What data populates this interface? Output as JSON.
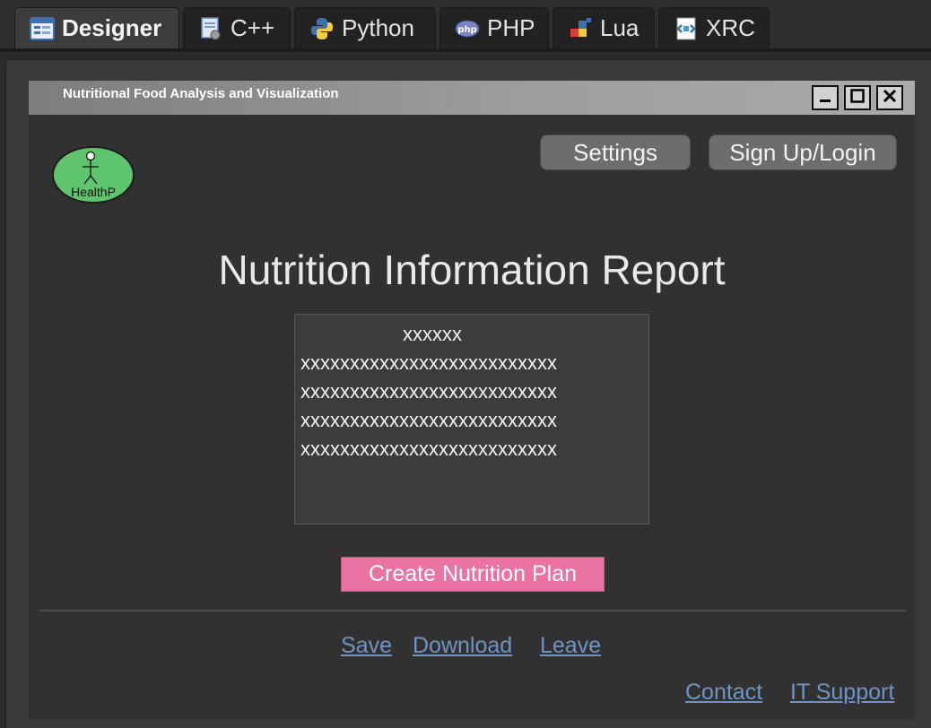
{
  "tabs": [
    {
      "label": "Designer",
      "icon": "designer-form-icon"
    },
    {
      "label": "C++",
      "icon": "cpp-file-icon"
    },
    {
      "label": "Python",
      "icon": "python-icon"
    },
    {
      "label": "PHP",
      "icon": "php-icon"
    },
    {
      "label": "Lua",
      "icon": "lua-icon"
    },
    {
      "label": "XRC",
      "icon": "xrc-icon"
    }
  ],
  "frame": {
    "title": "Nutritional Food Analysis and Visualization",
    "window_buttons": [
      "minimize-icon",
      "maximize-icon",
      "close-icon"
    ]
  },
  "header": {
    "settings_label": "Settings",
    "signup_label": "Sign Up/Login"
  },
  "logo": {
    "text": "HealthP",
    "color": "#5ec46e"
  },
  "report": {
    "title": "Nutrition Information Report",
    "box_header": "xxxxxx",
    "box_lines": [
      "xxxxxxxxxxxxxxxxxxxxxxxxxx",
      "xxxxxxxxxxxxxxxxxxxxxxxxxx",
      "xxxxxxxxxxxxxxxxxxxxxxxxxx",
      "xxxxxxxxxxxxxxxxxxxxxxxxxx"
    ]
  },
  "actions": {
    "create_plan_label": "Create Nutrition Plan",
    "create_plan_color": "#ea73a4"
  },
  "footer": {
    "links": [
      "Save",
      "Download",
      "Leave"
    ],
    "contact_label": "Contact",
    "it_support_label": "IT Support",
    "link_color": "#6f95c4"
  }
}
